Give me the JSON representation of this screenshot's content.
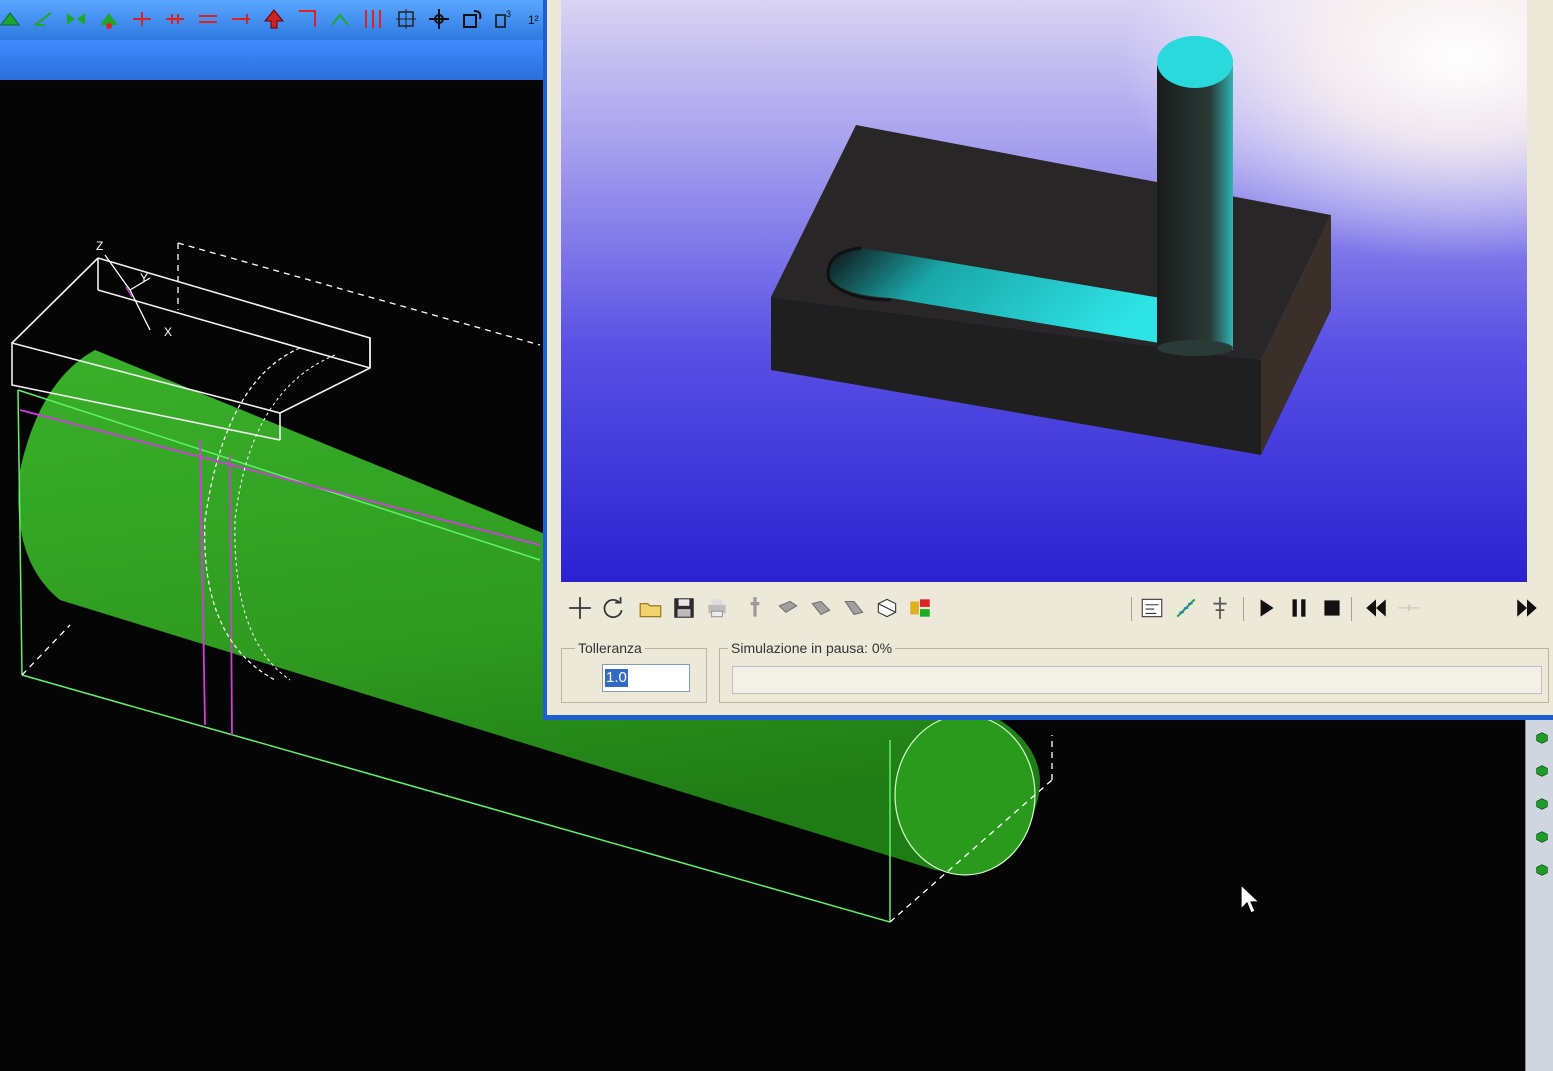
{
  "cad_view": {
    "axes": {
      "x": "X",
      "y": "Y",
      "z": "Z"
    },
    "colors": {
      "background": "#050505",
      "cylinder": "#2f9b20",
      "wire": "#f0f0f0",
      "bbox": "#5ff06a",
      "section": "#d23be0"
    }
  },
  "top_toolbar": {
    "icons": [
      "trim-icon",
      "extend-icon",
      "mirror-icon",
      "offset-icon",
      "break-icon",
      "join-icon",
      "parallel-icon",
      "perpendicular-icon",
      "fillet-icon",
      "chamfer-icon",
      "align-icon",
      "distribute-icon",
      "scale-icon",
      "move-icon",
      "rotate-icon",
      "copy-icon",
      "number-icon"
    ],
    "colors": {
      "background": "#3f8bff"
    }
  },
  "right_toolbar": {
    "icons": [
      "view-front-icon",
      "view-back-icon",
      "view-left-icon",
      "view-right-icon",
      "view-top-icon",
      "view-bottom-icon",
      "iso-view-1-icon",
      "iso-view-2-icon",
      "iso-view-3-icon",
      "iso-view-4-icon",
      "layer-icon",
      "solid-icon",
      "transform-icon",
      "surface-icon",
      "wire-icon"
    ]
  },
  "simulation": {
    "colors": {
      "background_top": "#f0eefa",
      "background_bottom": "#3a32d8",
      "part": "#262626",
      "machined": "#2ad9dc"
    },
    "toolbar": {
      "left_icons": [
        "add-icon",
        "refresh-icon",
        "open-icon",
        "save-icon",
        "print-icon",
        "tool-icon",
        "block-1-icon",
        "block-2-icon",
        "block-3-icon",
        "section-icon",
        "stock-icon"
      ],
      "right_icons": [
        "report-icon",
        "toolpath-icon",
        "tool-holder-icon"
      ],
      "playback": [
        "play-icon",
        "pause-icon",
        "stop-icon",
        "rewind-icon",
        "speed-slider",
        "fast-forward-icon"
      ],
      "speed_level": 0.5
    },
    "tolerance": {
      "label": "Tolleranza",
      "value": "1.0"
    },
    "status": {
      "label": "Simulazione in pausa: 0%",
      "progress": 0
    }
  }
}
